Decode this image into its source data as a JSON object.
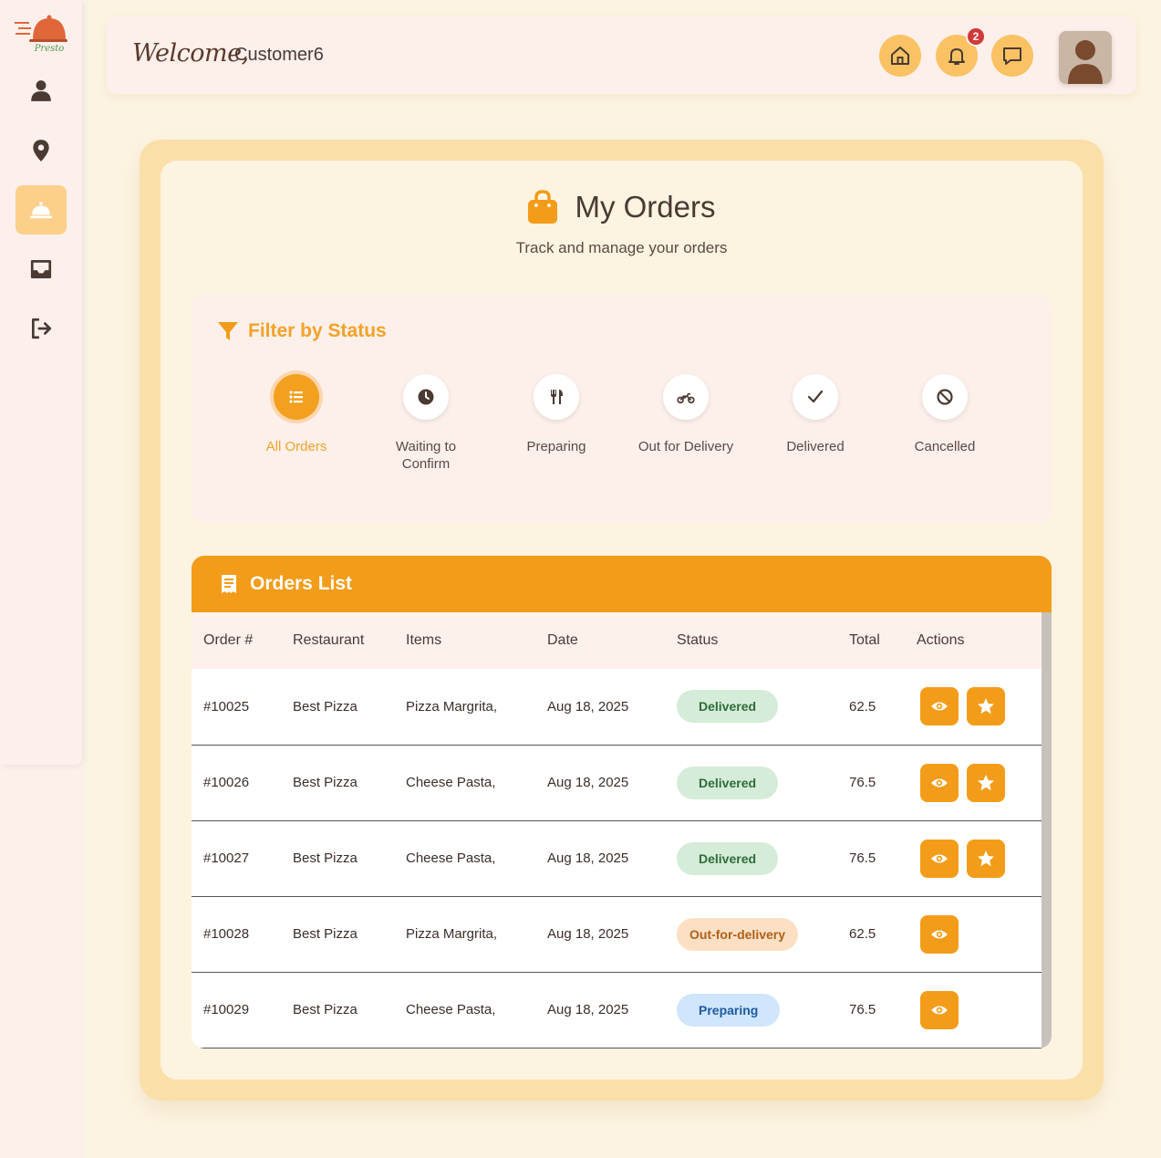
{
  "brand": {
    "logo_text": "Presto"
  },
  "sidebar": {
    "items": [
      {
        "name": "profile",
        "icon": "user-icon"
      },
      {
        "name": "locations",
        "icon": "location-pin-icon"
      },
      {
        "name": "orders",
        "icon": "service-bell-icon",
        "active": true
      },
      {
        "name": "inbox",
        "icon": "inbox-icon"
      },
      {
        "name": "logout",
        "icon": "logout-icon"
      }
    ]
  },
  "header": {
    "welcome": "Welcome,",
    "username": "Customer6",
    "notification_count": "2",
    "buttons": [
      "home-icon",
      "bell-icon",
      "chat-icon"
    ]
  },
  "page": {
    "title": "My Orders",
    "subtitle": "Track and manage your orders"
  },
  "filter": {
    "title": "Filter by Status",
    "options": [
      {
        "label": "All Orders",
        "icon": "list-icon",
        "active": true
      },
      {
        "label": "Waiting to Confirm",
        "icon": "clock-icon"
      },
      {
        "label": "Preparing",
        "icon": "utensils-icon"
      },
      {
        "label": "Out for Delivery",
        "icon": "motorcycle-icon"
      },
      {
        "label": "Delivered",
        "icon": "check-icon"
      },
      {
        "label": "Cancelled",
        "icon": "ban-icon"
      }
    ]
  },
  "orders": {
    "title": "Orders List",
    "columns": [
      "Order #",
      "Restaurant",
      "Items",
      "Date",
      "Status",
      "Total",
      "Actions"
    ],
    "rows": [
      {
        "order": "#10025",
        "restaurant": "Best Pizza",
        "items": "Pizza Margrita,",
        "date": "Aug 18, 2025",
        "status": "Delivered",
        "status_type": "delivered",
        "total": "62.5",
        "rate": true
      },
      {
        "order": "#10026",
        "restaurant": "Best Pizza",
        "items": "Cheese Pasta,",
        "date": "Aug 18, 2025",
        "status": "Delivered",
        "status_type": "delivered",
        "total": "76.5",
        "rate": true
      },
      {
        "order": "#10027",
        "restaurant": "Best Pizza",
        "items": "Cheese Pasta,",
        "date": "Aug 18, 2025",
        "status": "Delivered",
        "status_type": "delivered",
        "total": "76.5",
        "rate": true
      },
      {
        "order": "#10028",
        "restaurant": "Best Pizza",
        "items": "Pizza Margrita,",
        "date": "Aug 18, 2025",
        "status": "Out-for-delivery",
        "status_type": "out",
        "total": "62.5",
        "rate": false
      },
      {
        "order": "#10029",
        "restaurant": "Best Pizza",
        "items": "Cheese Pasta,",
        "date": "Aug 18, 2025",
        "status": "Preparing",
        "status_type": "preparing",
        "total": "76.5",
        "rate": false
      }
    ]
  },
  "colors": {
    "accent": "#f39c19",
    "background": "#fcf4e2",
    "delivered": "#d4ecd8",
    "out_for_delivery": "#fde0c4",
    "preparing": "#cfe6fc"
  }
}
